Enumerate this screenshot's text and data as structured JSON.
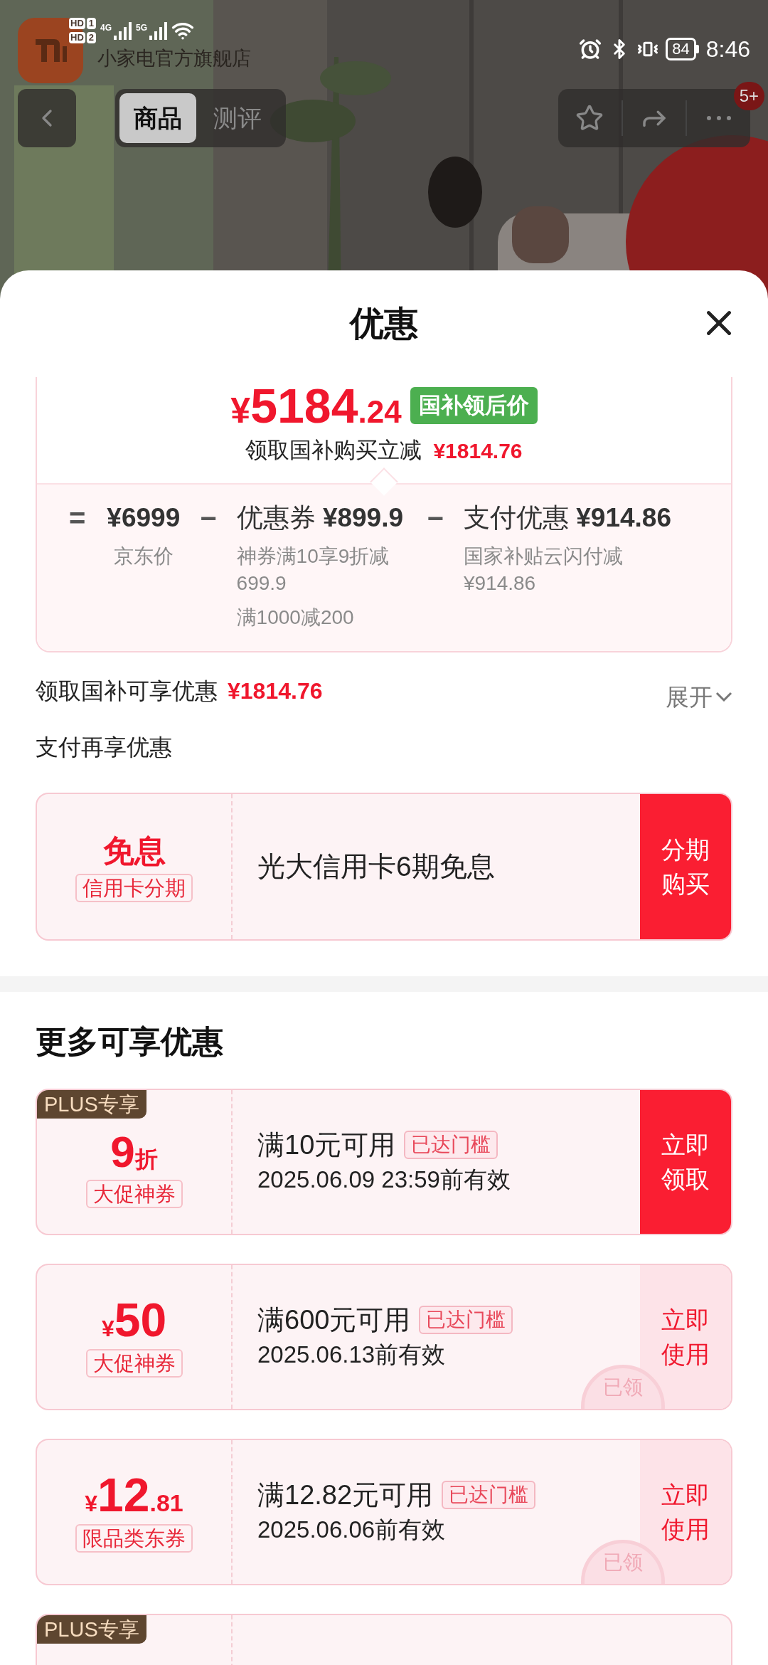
{
  "status_bar": {
    "sims": [
      {
        "label": "HD",
        "slot": "1"
      },
      {
        "label": "HD",
        "slot": "2"
      }
    ],
    "networks": [
      "4G",
      "5G"
    ],
    "battery": "84",
    "time": "8:46"
  },
  "store": {
    "name": "小家电官方旗舰店"
  },
  "nav": {
    "tabs": [
      {
        "label": "商品",
        "selected": true
      },
      {
        "label": "测评",
        "selected": false
      }
    ],
    "badge": "5+"
  },
  "sheet": {
    "title": "优惠",
    "price": {
      "currency": "¥",
      "integer": "5184",
      "decimal": ".24",
      "tag": "国补领后价",
      "note": "领取国补购买立减",
      "note_amount": "¥1814.76"
    },
    "breakdown": [
      {
        "operator": "=",
        "amount": "¥6999",
        "notes": [
          "京东价"
        ]
      },
      {
        "operator": "−",
        "label": "优惠券",
        "amount": "¥899.9",
        "notes": [
          "神券满10享9折减699.9",
          "满1000减200"
        ]
      },
      {
        "operator": "−",
        "label": "支付优惠",
        "amount": "¥914.86",
        "notes": [
          "国家补贴云闪付减¥914.86"
        ]
      }
    ],
    "subsidy": {
      "label": "领取国补可享优惠",
      "amount": "¥1814.76",
      "toggle": "展开",
      "expanded": false
    },
    "payment": {
      "heading": "支付再享优惠",
      "offer": {
        "title": "免息",
        "tag": "信用卡分期",
        "description": "光大信用卡6期免息",
        "action": "分期购买"
      }
    },
    "more": {
      "heading": "更多可享优惠",
      "coupons": [
        {
          "kind": "discount",
          "badge": "PLUS专享",
          "value": "9",
          "unit": "折",
          "tag": "大促神券",
          "condition": "满10元可用",
          "threshold": "已达门槛",
          "validity": "2025.06.09 23:59前有效",
          "action": "立即领取",
          "claimed": false
        },
        {
          "kind": "amount",
          "currency": "¥",
          "value": "50",
          "tag": "大促神券",
          "condition": "满600元可用",
          "threshold": "已达门槛",
          "validity": "2025.06.13前有效",
          "action": "立即使用",
          "claimed": true,
          "stamp": "已领"
        },
        {
          "kind": "amount",
          "currency": "¥",
          "value": "12",
          "decimal": ".81",
          "tag": "限品类东券",
          "condition": "满12.82元可用",
          "threshold": "已达门槛",
          "validity": "2025.06.06前有效",
          "action": "立即使用",
          "claimed": true,
          "stamp": "已领"
        },
        {
          "kind": "partial",
          "badge": "PLUS专享"
        }
      ]
    }
  }
}
